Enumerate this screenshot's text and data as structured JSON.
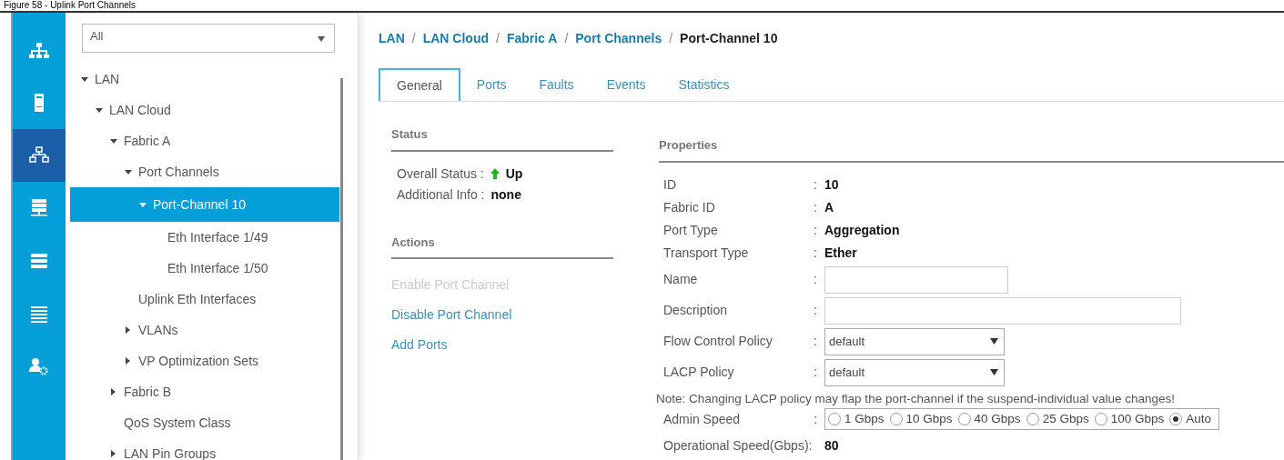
{
  "caption": "Figure 58 - Uplink Port Channels",
  "rail": [
    {
      "kind": "tree",
      "selected": false
    },
    {
      "kind": "server",
      "selected": false
    },
    {
      "kind": "network",
      "selected": true
    },
    {
      "kind": "stack",
      "selected": false
    },
    {
      "kind": "storage",
      "selected": false
    },
    {
      "kind": "list",
      "selected": false
    },
    {
      "kind": "admin",
      "selected": false
    }
  ],
  "filter": {
    "value": "All"
  },
  "tree": [
    {
      "label": "LAN",
      "expanded": true,
      "selected": false,
      "children": [
        {
          "label": "LAN Cloud",
          "expanded": true,
          "selected": false,
          "children": [
            {
              "label": "Fabric A",
              "expanded": true,
              "selected": false,
              "children": [
                {
                  "label": "Port Channels",
                  "expanded": true,
                  "selected": false,
                  "children": [
                    {
                      "label": "Port-Channel 10",
                      "expanded": true,
                      "selected": true,
                      "children": [
                        {
                          "label": "Eth Interface 1/49",
                          "selected": false
                        },
                        {
                          "label": "Eth Interface 1/50",
                          "selected": false
                        }
                      ]
                    }
                  ]
                },
                {
                  "label": "Uplink Eth Interfaces",
                  "selected": false
                },
                {
                  "label": "VLANs",
                  "expanded": false,
                  "selected": false
                },
                {
                  "label": "VP Optimization Sets",
                  "expanded": false,
                  "selected": false
                }
              ]
            },
            {
              "label": "Fabric B",
              "expanded": false,
              "selected": false
            },
            {
              "label": "QoS System Class",
              "selected": false
            },
            {
              "label": "LAN Pin Groups",
              "expanded": false,
              "selected": false
            }
          ]
        }
      ]
    }
  ],
  "breadcrumb": [
    {
      "label": "LAN"
    },
    {
      "separator": "/",
      "label": "LAN Cloud"
    },
    {
      "separator": "/",
      "label": "Fabric A"
    },
    {
      "separator": "/",
      "label": "Port Channels"
    },
    {
      "separator": "/",
      "label": "Port-Channel 10"
    }
  ],
  "tabs": [
    {
      "label": "General",
      "selected": true
    },
    {
      "label": "Ports",
      "selected": false
    },
    {
      "label": "Faults",
      "selected": false
    },
    {
      "label": "Events",
      "selected": false
    },
    {
      "label": "Statistics",
      "selected": false
    }
  ],
  "status": {
    "title": "Status",
    "overall_label": "Overall Status :",
    "overall_value": "Up",
    "info_label": "Additional Info :",
    "info_value": "none"
  },
  "actions": {
    "title": "Actions",
    "items": [
      {
        "label": "Enable Port Channel",
        "disabled": true
      },
      {
        "label": "Disable Port Channel",
        "disabled": false
      },
      {
        "label": "Add Ports",
        "disabled": false
      }
    ]
  },
  "properties": {
    "title": "Properties",
    "rows": [
      {
        "kind": "text",
        "label": "ID",
        "colon": ":",
        "value": "10"
      },
      {
        "kind": "text",
        "label": "Fabric ID",
        "colon": ":",
        "value": "A"
      },
      {
        "kind": "text",
        "label": "Port Type",
        "colon": ":",
        "value": "Aggregation"
      },
      {
        "kind": "text",
        "label": "Transport Type",
        "colon": ":",
        "value": "Ether"
      },
      {
        "kind": "short_input",
        "label": "Name",
        "colon": ":"
      },
      {
        "kind": "long_input",
        "label": "Description",
        "colon": ":"
      },
      {
        "kind": "select",
        "label": "Flow Control Policy",
        "colon": ":",
        "value": "default"
      },
      {
        "kind": "select",
        "label": "LACP Policy",
        "colon": ":",
        "value": "default"
      },
      {
        "kind": "note",
        "text": "Note: Changing LACP policy may flap the port-channel if the suspend-individual value changes!"
      },
      {
        "kind": "radio",
        "label": "Admin Speed",
        "colon": ":",
        "options": [
          {
            "label": "1 Gbps",
            "selected": false
          },
          {
            "label": "10 Gbps",
            "selected": false
          },
          {
            "label": "40 Gbps",
            "selected": false
          },
          {
            "label": "25 Gbps",
            "selected": false
          },
          {
            "label": "100 Gbps",
            "selected": false
          },
          {
            "label": "Auto",
            "selected": true
          }
        ]
      },
      {
        "kind": "text",
        "label": "Operational Speed(Gbps):",
        "value": "80"
      }
    ]
  }
}
